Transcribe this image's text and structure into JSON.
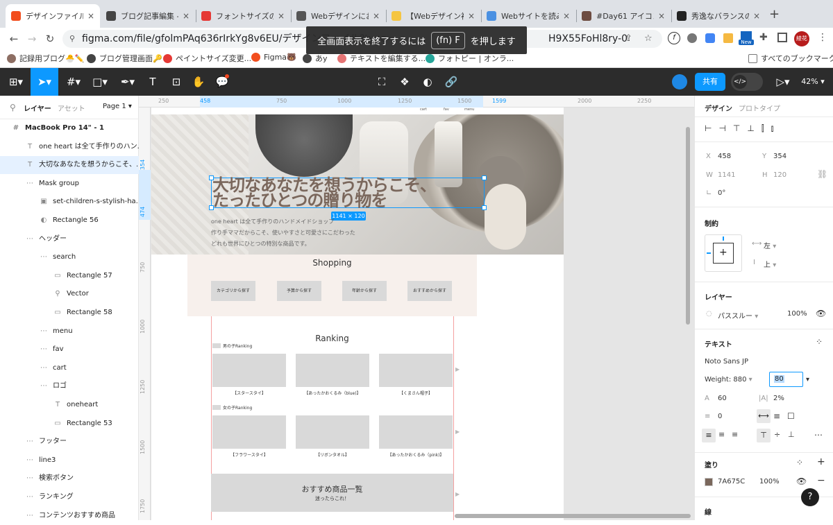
{
  "browser": {
    "tabs": [
      {
        "label": "デザインファイル -",
        "color": "#f24e1e",
        "active": true
      },
      {
        "label": "ブログ記事編集 - l",
        "color": "#444"
      },
      {
        "label": "フォントサイズの",
        "color": "#e53935"
      },
      {
        "label": "Webデザインにお",
        "color": "#555"
      },
      {
        "label": "【Webデザイン初",
        "color": "#f5c542"
      },
      {
        "label": "Webサイトを読み",
        "color": "#4a90e2"
      },
      {
        "label": "#Day61 アイコン",
        "color": "#6d4c41"
      },
      {
        "label": "秀逸なバランスの",
        "color": "#222"
      }
    ],
    "new_tab": "+",
    "url": "figma.com/file/gfolmPAq636rIrkYg8v6EU/デザインファイル?type=",
    "url_tail": "H9X55FoHl8ry-0",
    "fullscreen_notice": {
      "prefix": "全画面表示を終了するには",
      "key": "(fn) F",
      "suffix": "を押します"
    },
    "profile_label": "綾花",
    "new_badge": "New",
    "bookmarks": [
      {
        "label": "記録用ブログ🐣✏️",
        "color": "#8d6e63"
      },
      {
        "label": "ブログ管理画面🔑",
        "color": "#444"
      },
      {
        "label": "ペイントサイズ変更...",
        "color": "#e53935"
      },
      {
        "label": "Figma🐻",
        "color": "#f24e1e"
      },
      {
        "label": "あy",
        "color": "#444"
      },
      {
        "label": "テキストを編集する...",
        "color": "#e57373"
      },
      {
        "label": "フォトピー | オンラ...",
        "color": "#26a69a"
      }
    ],
    "all_bookmarks": "すべてのブックマーク"
  },
  "toolbar": {
    "share_label": "共有",
    "zoom": "42%",
    "code_icon": "</>"
  },
  "layers": {
    "tab_layers": "レイヤー",
    "tab_assets": "アセット",
    "page_label": "Page 1",
    "items": [
      {
        "label": "MacBook Pro 14\" - 1",
        "icon": "#",
        "indent": 0,
        "bold": true
      },
      {
        "label": "one heart は全て手作りのハン...",
        "icon": "T",
        "indent": 1
      },
      {
        "label": "大切なあなたを想うからこそ、...",
        "icon": "T",
        "indent": 1,
        "selected": true
      },
      {
        "label": "Mask group",
        "icon": "⋯",
        "indent": 1
      },
      {
        "label": "set-children-s-stylish-ha...",
        "icon": "▣",
        "indent": 2
      },
      {
        "label": "Rectangle 56",
        "icon": "◐",
        "indent": 2
      },
      {
        "label": "ヘッダー",
        "icon": "⋯",
        "indent": 1
      },
      {
        "label": "search",
        "icon": "⋯",
        "indent": 2
      },
      {
        "label": "Rectangle 57",
        "icon": "▭",
        "indent": 3
      },
      {
        "label": "Vector",
        "icon": "⚲",
        "indent": 3
      },
      {
        "label": "Rectangle 58",
        "icon": "▭",
        "indent": 3
      },
      {
        "label": "menu",
        "icon": "⋯",
        "indent": 2
      },
      {
        "label": "fav",
        "icon": "⋯",
        "indent": 2
      },
      {
        "label": "cart",
        "icon": "⋯",
        "indent": 2
      },
      {
        "label": "ロゴ",
        "icon": "⋯",
        "indent": 2
      },
      {
        "label": "oneheart",
        "icon": "T",
        "indent": 3
      },
      {
        "label": "Rectangle 53",
        "icon": "▭",
        "indent": 3
      },
      {
        "label": "フッター",
        "icon": "⋯",
        "indent": 1
      },
      {
        "label": "line3",
        "icon": "⋯",
        "indent": 1
      },
      {
        "label": "検索ボタン",
        "icon": "⋯",
        "indent": 1
      },
      {
        "label": "ランキング",
        "icon": "⋯",
        "indent": 1
      },
      {
        "label": "コンテンツおすすめ商品",
        "icon": "⋯",
        "indent": 1
      }
    ]
  },
  "canvas": {
    "ruler_top": [
      "250",
      "458",
      "750",
      "1000",
      "1250",
      "1500",
      "1599",
      "2000",
      "2250"
    ],
    "ruler_left": [
      "354",
      "474",
      "750",
      "1000",
      "1250",
      "1500",
      "1750"
    ],
    "header_links": [
      "cart",
      "fav",
      "menu"
    ],
    "hero_line1": "大切なあなたを想うからこそ、",
    "hero_line2": "たったひとつの贈り物を",
    "size_badge": "1141 × 120",
    "hero_body": [
      "one heart は全て手作りのハンドメイドショップ",
      "作り手ママだからこそ、使いやすさと可愛さにこだわった",
      "どれも世界にひとつの特別な商品です。"
    ],
    "shopping_title": "Shopping",
    "shopping_buttons": [
      "カテゴリから探す",
      "予算から探す",
      "年齢から探す",
      "おすすめから探す"
    ],
    "ranking_title": "Ranking",
    "boys_label": "男の子Ranking",
    "boys_items": [
      "【スタースタイ】",
      "【あったかおくるみ（blue)】",
      "【くまさん帽子】"
    ],
    "girls_label": "女の子Ranking",
    "girls_items": [
      "【フラワースタイ】",
      "【リボンタオル】",
      "【あったかおくるみ（pink)】"
    ],
    "recommend_title": "おすすめ商品一覧",
    "recommend_sub": "迷ったらこれ！"
  },
  "props": {
    "tab_design": "デザイン",
    "tab_prototype": "プロトタイプ",
    "x_label": "X",
    "x_value": "458",
    "y_label": "Y",
    "y_value": "354",
    "w_label": "W",
    "w_value": "1141",
    "h_label": "H",
    "h_value": "120",
    "rotation": "0°",
    "constraints_title": "制約",
    "constraint_h": "左",
    "constraint_v": "上",
    "layer_title": "レイヤー",
    "blend": "パススルー",
    "opacity": "100%",
    "text_title": "テキスト",
    "font": "Noto Sans JP",
    "weight": "Weight: 880",
    "font_size": "80",
    "line_height": "60",
    "letter_spacing": "2%",
    "para_spacing": "0",
    "fill_title": "塗り",
    "fill_hex": "7A675C",
    "fill_opacity": "100%",
    "fill_color": "#7A675C",
    "stroke_title": "線",
    "help": "?"
  }
}
